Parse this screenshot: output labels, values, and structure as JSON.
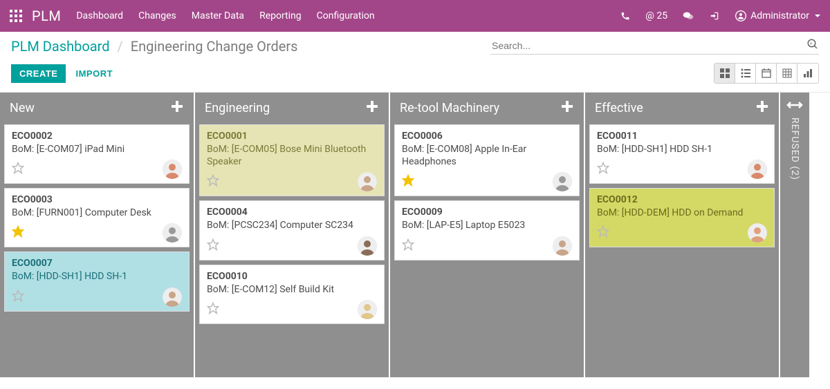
{
  "topnav": {
    "brand": "PLM",
    "menu": [
      "Dashboard",
      "Changes",
      "Master Data",
      "Reporting",
      "Configuration"
    ],
    "messageCount": "@ 25",
    "user": "Administrator"
  },
  "breadcrumb": {
    "parent": "PLM Dashboard",
    "current": "Engineering Change Orders"
  },
  "search": {
    "placeholder": "Search..."
  },
  "buttons": {
    "create": "CREATE",
    "import": "IMPORT"
  },
  "columns": [
    {
      "title": "New",
      "cards": [
        {
          "id": "ECO0002",
          "desc": "BoM: [E-COM07] iPad Mini",
          "starred": false,
          "avatarColor": "#d98a6c",
          "highlight": ""
        },
        {
          "id": "ECO0003",
          "desc": "BoM: [FURN001] Computer Desk",
          "starred": true,
          "avatarColor": "#999",
          "highlight": ""
        },
        {
          "id": "ECO0007",
          "desc": "BoM: [HDD-SH1] HDD SH-1",
          "starred": false,
          "avatarColor": "#c9a589",
          "highlight": "blue"
        }
      ]
    },
    {
      "title": "Engineering",
      "cards": [
        {
          "id": "ECO0001",
          "desc": "BoM: [E-COM05] Bose Mini Bluetooth Speaker",
          "starred": false,
          "avatarColor": "#c9a589",
          "highlight": "yellow"
        },
        {
          "id": "ECO0004",
          "desc": "BoM: [PCSC234] Computer SC234",
          "starred": false,
          "avatarColor": "#8a6d5a",
          "highlight": ""
        },
        {
          "id": "ECO0010",
          "desc": "BoM: [E-COM12] Self Build Kit",
          "starred": false,
          "avatarColor": "#e0c78a",
          "highlight": ""
        }
      ]
    },
    {
      "title": "Re-tool Machinery",
      "cards": [
        {
          "id": "ECO0006",
          "desc": "BoM: [E-COM08] Apple In-Ear Headphones",
          "starred": true,
          "avatarColor": "#999",
          "highlight": ""
        },
        {
          "id": "ECO0009",
          "desc": "BoM: [LAP-E5] Laptop E5023",
          "starred": false,
          "avatarColor": "#c9a589",
          "highlight": ""
        }
      ]
    },
    {
      "title": "Effective",
      "cards": [
        {
          "id": "ECO0011",
          "desc": "BoM: [HDD-SH1] HDD SH-1",
          "starred": false,
          "avatarColor": "#d98a6c",
          "highlight": ""
        },
        {
          "id": "ECO0012",
          "desc": "BoM: [HDD-DEM] HDD on Demand",
          "starred": false,
          "avatarColor": "#e0a080",
          "highlight": "olive"
        }
      ]
    }
  ],
  "folded": {
    "label": "REFUSED (2)"
  }
}
